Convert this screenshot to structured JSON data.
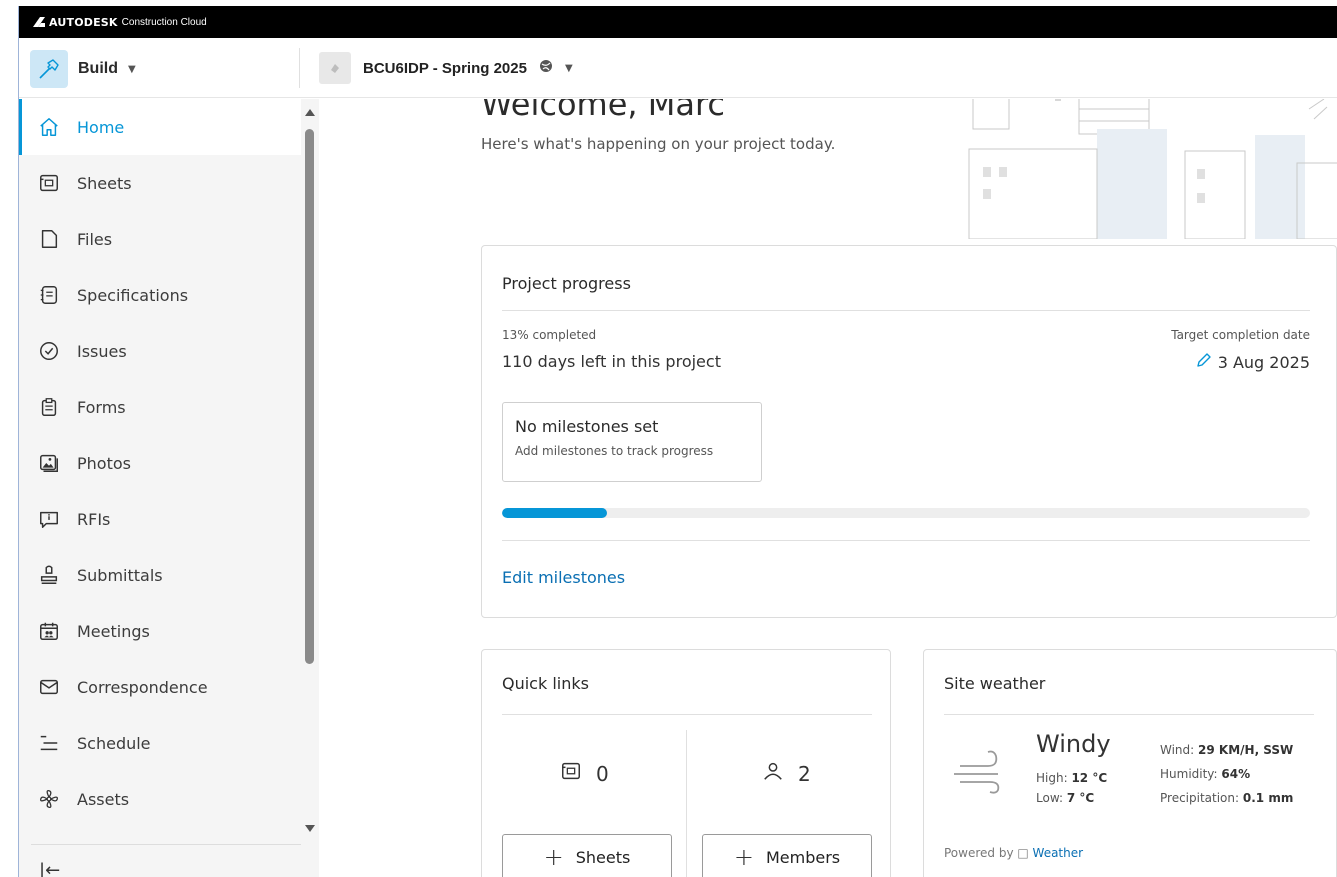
{
  "topbar": {
    "brand_bold": "AUTODESK",
    "brand_light": "Construction Cloud"
  },
  "header": {
    "module": "Build",
    "project": "BCU6IDP - Spring 2025"
  },
  "sidebar": {
    "items": [
      {
        "label": "Home",
        "icon": "home-icon",
        "active": true
      },
      {
        "label": "Sheets",
        "icon": "sheets-icon"
      },
      {
        "label": "Files",
        "icon": "file-icon"
      },
      {
        "label": "Specifications",
        "icon": "specifications-icon"
      },
      {
        "label": "Issues",
        "icon": "issues-check-icon"
      },
      {
        "label": "Forms",
        "icon": "clipboard-icon"
      },
      {
        "label": "Photos",
        "icon": "photos-icon"
      },
      {
        "label": "RFIs",
        "icon": "rfi-icon"
      },
      {
        "label": "Submittals",
        "icon": "stamp-icon"
      },
      {
        "label": "Meetings",
        "icon": "calendar-people-icon"
      },
      {
        "label": "Correspondence",
        "icon": "envelope-icon"
      },
      {
        "label": "Schedule",
        "icon": "schedule-icon"
      },
      {
        "label": "Assets",
        "icon": "assets-icon"
      }
    ],
    "collapse_label": "|←"
  },
  "main": {
    "welcome": "Welcome, Marc",
    "subtitle": "Here's what's happening on your project today.",
    "progress": {
      "title": "Project progress",
      "percent_label": "13% completed",
      "percent": 13,
      "days_left": "110 days left in this project",
      "target_label": "Target completion date",
      "target_date": "3 Aug 2025",
      "milestone_title": "No milestones set",
      "milestone_sub": "Add milestones to track progress",
      "edit_link": "Edit milestones"
    },
    "quick_links": {
      "title": "Quick links",
      "sheets_count": "0",
      "members_count": "2",
      "sheets_btn": "Sheets",
      "members_btn": "Members"
    },
    "weather": {
      "title": "Site weather",
      "condition": "Windy",
      "high_label": "High:",
      "high": "12 °C",
      "low_label": "Low:",
      "low": "7 °C",
      "wind_label": "Wind:",
      "wind": "29 KM/H, SSW",
      "humidity_label": "Humidity:",
      "humidity": "64%",
      "precip_label": "Precipitation:",
      "precip": "0.1 mm",
      "powered_by": "Powered by □",
      "provider": "Weather"
    }
  },
  "colors": {
    "accent": "#0696d7",
    "link": "#0a6fb3",
    "build_icon_bg": "#cde7f6"
  }
}
